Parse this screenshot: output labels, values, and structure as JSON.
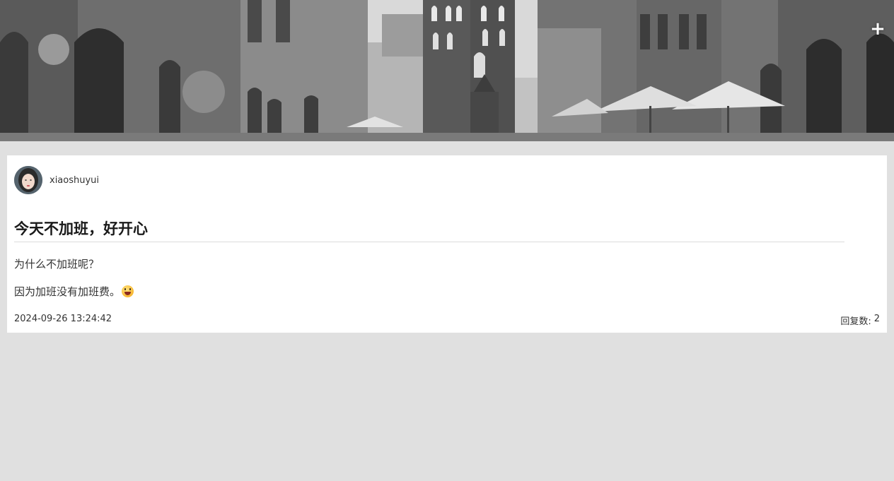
{
  "header": {
    "add_button_label": "+"
  },
  "post": {
    "author": "xiaoshuyui",
    "title": "今天不加班，好开心",
    "paragraphs": [
      "为什么不加班呢？",
      "因为加班没有加班费。"
    ],
    "emoji": "grinning-face-emoji",
    "date": "2024-09-26 13:24:42",
    "replies_label": "回复数:",
    "replies_count": "2"
  },
  "colors": {
    "background": "#e0e0e0",
    "card": "#ffffff",
    "text": "#222222"
  }
}
